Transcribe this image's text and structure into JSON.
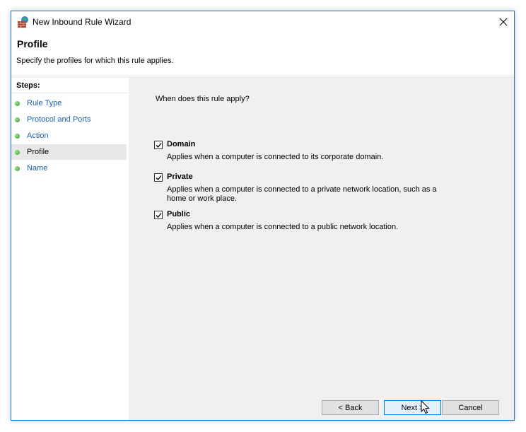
{
  "window": {
    "title": "New Inbound Rule Wizard"
  },
  "header": {
    "title": "Profile",
    "subtitle": "Specify the profiles for which this rule applies."
  },
  "sidebar": {
    "title": "Steps:",
    "items": [
      {
        "label": "Rule Type",
        "active": false
      },
      {
        "label": "Protocol and Ports",
        "active": false
      },
      {
        "label": "Action",
        "active": false
      },
      {
        "label": "Profile",
        "active": true
      },
      {
        "label": "Name",
        "active": false
      }
    ]
  },
  "main": {
    "question": "When does this rule apply?",
    "options": [
      {
        "label": "Domain",
        "checked": true,
        "description": "Applies when a computer is connected to its corporate domain."
      },
      {
        "label": "Private",
        "checked": true,
        "description": "Applies when a computer is connected to a private network location, such as a home or work place."
      },
      {
        "label": "Public",
        "checked": true,
        "description": "Applies when a computer is connected to a public network location."
      }
    ]
  },
  "buttons": {
    "back": "< Back",
    "next": "Next >",
    "cancel": "Cancel"
  },
  "colors": {
    "window_border": "#1979ca",
    "link": "#1a5ea8",
    "step_dot": "#2f9a22",
    "content_bg": "#f0f0f0"
  },
  "icons": {
    "app": "firewall-brick-globe-icon",
    "close": "close-icon",
    "step": "green-dot-icon",
    "check": "checkmark-icon",
    "cursor": "mouse-pointer-icon"
  }
}
